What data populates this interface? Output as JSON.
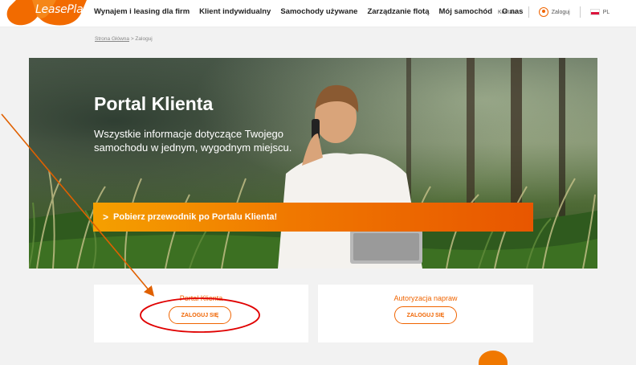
{
  "header": {
    "logo_text": "LeasePlan",
    "nav": [
      "Wynajem i leasing dla firm",
      "Klient indywidualny",
      "Samochody używane",
      "Zarządzanie flotą",
      "Mój samochód",
      "O nas"
    ],
    "kontakt": "Kontakt",
    "zaloguj": "Zaloguj",
    "language": "PL"
  },
  "breadcrumb": {
    "home": "Strona Główna",
    "separator": ">",
    "current": "Zaloguj"
  },
  "hero": {
    "title": "Portal Klienta",
    "subtitle": "Wszystkie informacje dotyczące Twojego samochodu w jednym, wygodnym miejscu.",
    "cta": "Pobierz przewodnik po Portalu Klienta!"
  },
  "cards": [
    {
      "title": "Portal Klienta",
      "button": "ZALOGUJ SIĘ"
    },
    {
      "title": "Autoryzacja napraw",
      "button": "ZALOGUJ SIĘ"
    }
  ],
  "colors": {
    "brand_orange": "#f06400",
    "annotation_red": "#e00000",
    "annotation_arrow": "#e06000"
  },
  "icons": [
    "user-icon",
    "pl-flag-icon",
    "chevron-right-icon"
  ]
}
